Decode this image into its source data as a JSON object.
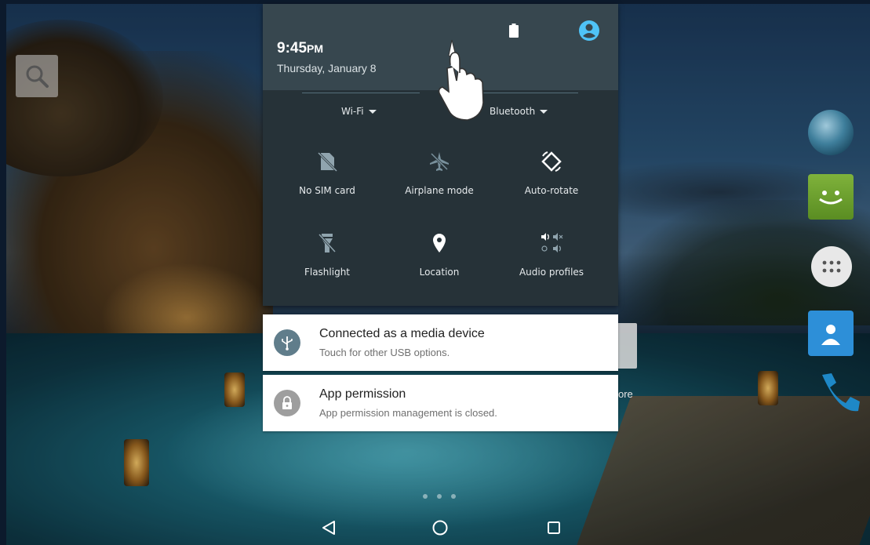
{
  "quick_settings": {
    "time": "9:45",
    "ampm": "PM",
    "date": "Thursday, January 8",
    "wifi_label": "Wi-Fi",
    "bluetooth_label": "Bluetooth",
    "tiles": {
      "sim": "No SIM card",
      "airplane": "Airplane mode",
      "rotate": "Auto-rotate",
      "flashlight": "Flashlight",
      "location": "Location",
      "audio": "Audio profiles"
    }
  },
  "notifications": [
    {
      "title": "Connected as a media device",
      "text": "Touch for other USB options.",
      "icon": "usb-icon"
    },
    {
      "title": "App permission",
      "text": "App permission management is closed.",
      "icon": "lock-icon"
    }
  ],
  "home": {
    "partial_label": "ore"
  },
  "colors": {
    "panel_bg": "#263238",
    "header_bg": "#37474f",
    "accent": "#4fc3f7"
  }
}
